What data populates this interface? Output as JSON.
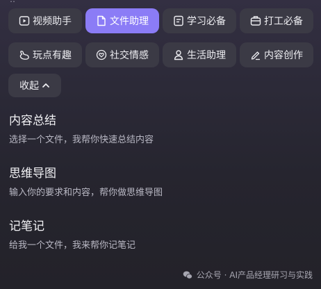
{
  "chips": [
    {
      "label": "视频助手",
      "icon": "video-icon",
      "active": false
    },
    {
      "label": "文件助理",
      "icon": "document-icon",
      "active": true
    },
    {
      "label": "学习必备",
      "icon": "study-icon",
      "active": false
    },
    {
      "label": "打工必备",
      "icon": "briefcase-icon",
      "active": false
    },
    {
      "label": "玩点有趣",
      "icon": "duck-icon",
      "active": false
    },
    {
      "label": "社交情感",
      "icon": "heart-icon",
      "active": false
    },
    {
      "label": "生活助理",
      "icon": "person-icon",
      "active": false
    },
    {
      "label": "内容创作",
      "icon": "pen-icon",
      "active": false
    }
  ],
  "collapse": {
    "label": "收起",
    "icon": "chevron-up-icon"
  },
  "sections": [
    {
      "title": "内容总结",
      "desc": "选择一个文件，我帮你快速总结内容"
    },
    {
      "title": "思维导图",
      "desc": "输入你的要求和内容，帮你做思维导图"
    },
    {
      "title": "记笔记",
      "desc": "给我一个文件，我来帮你记笔记"
    }
  ],
  "watermark": {
    "text": "公众号 · AI产品经理研习与实践",
    "icon": "wechat-icon"
  },
  "colors": {
    "accent": "#8b7cf6",
    "chip_bg": "#3b3a45"
  }
}
